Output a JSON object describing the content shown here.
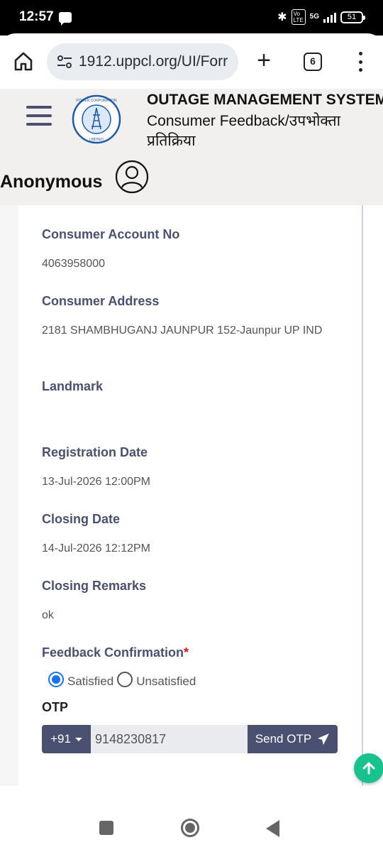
{
  "status_bar": {
    "time": "12:57",
    "network": "5G",
    "battery": "51"
  },
  "browser": {
    "url": "1912.uppcl.org/UI/Forr",
    "tab_count": "6"
  },
  "header": {
    "system_title": "OUTAGE MANAGEMENT SYSTEM",
    "subtitle": "Consumer Feedback/उपभोक्ता प्रतिक्रिया",
    "user_name": "Anonymous",
    "logo_text": "POWER CORPORATION LIMITED"
  },
  "fields": [
    {
      "label": "Consumer Account No",
      "value": "4063958000"
    },
    {
      "label": "Consumer Address",
      "value": "2181 SHAMBHUGANJ JAUNPUR 152-Jaunpur UP IND"
    },
    {
      "label": "Landmark",
      "value": ""
    },
    {
      "label": "Registration Date",
      "value": "13-Jul-2026 12:00PM"
    },
    {
      "label": "Closing Date",
      "value": "14-Jul-2026 12:12PM"
    },
    {
      "label": "Closing Remarks",
      "value": "ok"
    }
  ],
  "feedback": {
    "label": "Feedback Confirmation",
    "required_mark": "*",
    "options": [
      "Satisfied",
      "Unsatisfied"
    ],
    "selected": "Satisfied"
  },
  "otp": {
    "label": "OTP",
    "country_code": "+91",
    "phone": "9148230817",
    "send_label": "Send OTP"
  },
  "colors": {
    "primary": "#4a5170",
    "accent_green": "#17c28c",
    "radio_blue": "#1a73e8"
  }
}
